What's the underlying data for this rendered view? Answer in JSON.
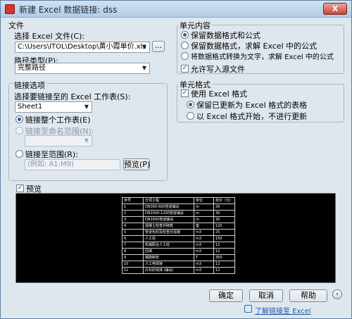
{
  "window": {
    "title": "新建 Excel 数据链接: dss",
    "close_label": "X"
  },
  "file": {
    "group_title": "文件",
    "choose_label": "选择 Excel 文件(C):",
    "file_path": "C:\\Users\\ITOL\\Desktop\\黄小霞单价.xls",
    "browse_label": "...",
    "path_type_label": "路径类型(P):",
    "path_type_value": "完整路径"
  },
  "link_options": {
    "group_title": "链接选项",
    "sheet_label": "选择要链接至的 Excel 工作表(S):",
    "sheet_value": "Sheet1",
    "link_whole_sheet": "链接整个工作表(E)",
    "link_named_range": "链接至命名范围(N):",
    "link_range": "链接至范围(R):",
    "range_placeholder": "(例如: A1:M9)",
    "preview_button": "预览(P)"
  },
  "cell_contents": {
    "group_title": "单元内容",
    "opt_keep_format_formula": "保留数据格式和公式",
    "opt_keep_format_solve": "保留数据格式，求解 Excel 中的公式",
    "opt_convert_text": "将数据格式转换为文字，求解 Excel 中的公式",
    "allow_write": "允许写入源文件"
  },
  "cell_format": {
    "group_title": "单元格式",
    "use_excel_format": "使用 Excel 格式",
    "opt_keep_updated": "保留已更新为 Excel 格式的表格",
    "opt_start_excel": "以 Excel 格式开始，不进行更新"
  },
  "preview": {
    "checkbox_label": "预览",
    "headers": [
      "序号",
      "分项工程",
      "单位",
      "单价（元）"
    ],
    "rows": [
      [
        "1",
        "DN300-600管道铺设",
        "m",
        "26"
      ],
      [
        "2",
        "DN1000-1200管道铺设",
        "m",
        "30"
      ],
      [
        "3",
        "DN1600管道铺设",
        "m",
        "30"
      ],
      [
        "4",
        "混凝土检查井砌筑",
        "座",
        "120"
      ],
      [
        "5",
        "管道包封及检查井混凝",
        "m3",
        "25"
      ],
      [
        "6",
        "人工挖",
        "m3",
        "150"
      ],
      [
        "7",
        "机械配合人工挖",
        "m3",
        "12"
      ],
      [
        "8",
        "回填",
        "m3",
        "12"
      ],
      [
        "9",
        "钢筋制安",
        "T",
        "350"
      ],
      [
        "10",
        "人工电焊接",
        "m3",
        "12"
      ],
      [
        "11",
        "片石砂找抹 (铺设)",
        "m3",
        "12"
      ]
    ]
  },
  "buttons": {
    "ok": "确定",
    "cancel": "取消",
    "help": "帮助",
    "expand": "‹"
  },
  "help_link": "了解链接至 Excel"
}
